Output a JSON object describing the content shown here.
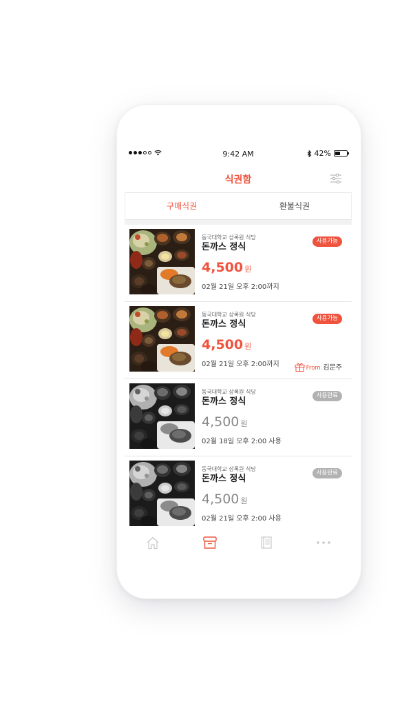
{
  "status_bar": {
    "time": "9:42 AM",
    "battery": "42%",
    "battery_level": 0.42
  },
  "header": {
    "title": "식권함"
  },
  "tabs": [
    {
      "label": "구매식권",
      "active": true
    },
    {
      "label": "환불식권",
      "active": false
    }
  ],
  "tickets": [
    {
      "restaurant": "동국대학교 상록원 식당",
      "menu": "돈까스 정식",
      "price": "4,500",
      "unit": "원",
      "date": "02월 21일 오후 2:00까지",
      "status": "사용가능",
      "used": false,
      "gift": null
    },
    {
      "restaurant": "동국대학교 상록원 식당",
      "menu": "돈까스 정식",
      "price": "4,500",
      "unit": "원",
      "date": "02월 21일 오후 2:00까지",
      "status": "사용가능",
      "used": false,
      "gift": {
        "from_label": "From.",
        "name": "김문주"
      }
    },
    {
      "restaurant": "동국대학교 상록원 식당",
      "menu": "돈까스 정식",
      "price": "4,500",
      "unit": "원",
      "date": "02월 18일 오후 2:00 사용",
      "status": "사용완료",
      "used": true,
      "gift": null
    },
    {
      "restaurant": "동국대학교 상록원 식당",
      "menu": "돈까스 정식",
      "price": "4,500",
      "unit": "원",
      "date": "02월 21일 오후 2:00 사용",
      "status": "사용완료",
      "used": true,
      "gift": null
    }
  ],
  "tab_bar": [
    {
      "icon": "home-icon",
      "active": false
    },
    {
      "icon": "ticket-box-icon",
      "active": true
    },
    {
      "icon": "notes-icon",
      "active": false
    },
    {
      "icon": "more-icon",
      "active": false
    }
  ],
  "colors": {
    "accent": "#f0533d",
    "badge_used": "#b2b2b2",
    "tab_inactive": "#c8c8c8"
  }
}
